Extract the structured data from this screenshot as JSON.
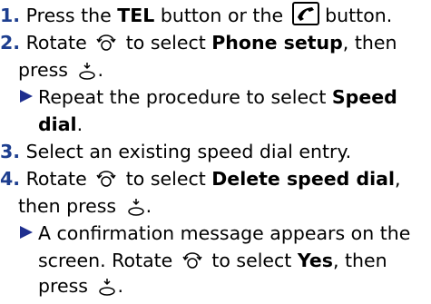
{
  "steps": [
    {
      "num": "1.",
      "a": "Press the ",
      "b": "TEL",
      "c": " button or the ",
      "d": " button."
    },
    {
      "num": "2.",
      "a": "Rotate ",
      "b": " to select ",
      "c": "Phone setup",
      "d": ", then",
      "e": "press ",
      "f": "."
    },
    {
      "sub": "Repeat the procedure to select ",
      "sub_b": "Speed",
      "sub_c": "dial",
      "sub_d": "."
    },
    {
      "num": "3.",
      "a": "Select an existing speed dial entry."
    },
    {
      "num": "4.",
      "a": "Rotate ",
      "b": " to select ",
      "c": "Delete speed dial",
      "d": ",",
      "e": "then press ",
      "f": "."
    },
    {
      "sub": "A confirmation message appears on the",
      "sub2": "screen. Rotate ",
      "sub3": " to select ",
      "sub_b": "Yes",
      "sub_c": ", then",
      "sub_d": "press ",
      "sub_e": "."
    }
  ]
}
